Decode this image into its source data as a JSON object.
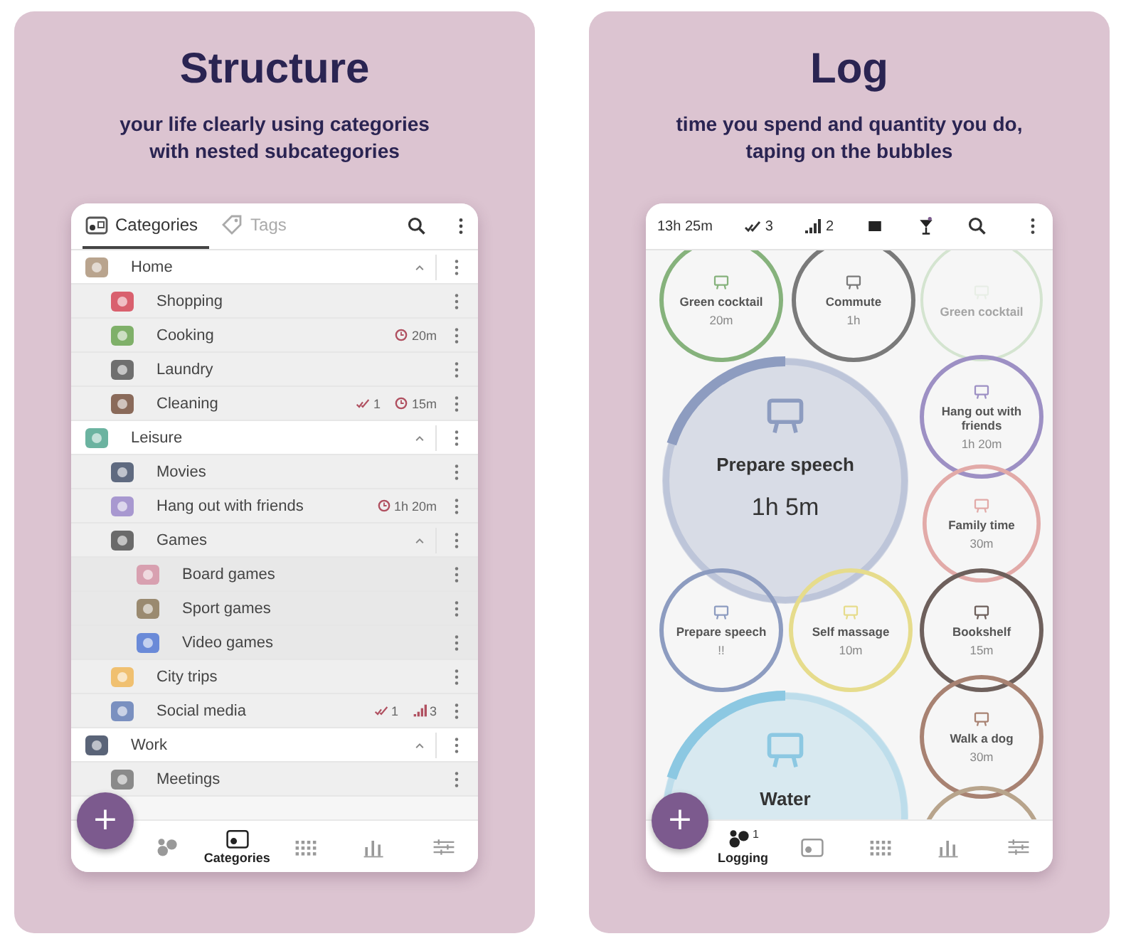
{
  "structure_panel": {
    "title": "Structure",
    "subtitle_lines": [
      "your life clearly using categories",
      "with nested subcategories"
    ],
    "phone": {
      "tabs": [
        {
          "label": "Categories",
          "kind": "categories",
          "selected": true
        },
        {
          "label": "Tags",
          "kind": "tags",
          "selected": false
        }
      ],
      "categories": [
        {
          "label": "Home",
          "color": "#b9a48e",
          "expanded": true,
          "children": [
            {
              "label": "Shopping",
              "color": "#d9606e"
            },
            {
              "label": "Cooking",
              "color": "#7fb069",
              "badges": [
                {
                  "kind": "timer",
                  "text": "20m"
                }
              ]
            },
            {
              "label": "Laundry",
              "color": "#6f6f6f"
            },
            {
              "label": "Cleaning",
              "color": "#8a6a5a",
              "badges": [
                {
                  "kind": "check",
                  "text": "1"
                },
                {
                  "kind": "timer",
                  "text": "15m"
                }
              ]
            }
          ]
        },
        {
          "label": "Leisure",
          "color": "#6bb3a0",
          "expanded": true,
          "children": [
            {
              "label": "Movies",
              "color": "#5f6a80"
            },
            {
              "label": "Hang out with friends",
              "color": "#a898d0",
              "badges": [
                {
                  "kind": "timer",
                  "text": "1h 20m"
                }
              ]
            },
            {
              "label": "Games",
              "color": "#6a6a6a",
              "expanded": true,
              "children": [
                {
                  "label": "Board games",
                  "color": "#d8a0b0"
                },
                {
                  "label": "Sport games",
                  "color": "#9a8a70"
                },
                {
                  "label": "Video games",
                  "color": "#6a8ad8"
                }
              ]
            },
            {
              "label": "City trips",
              "color": "#f0c070"
            },
            {
              "label": "Social media",
              "color": "#7a90c0",
              "badges": [
                {
                  "kind": "check",
                  "text": "1"
                },
                {
                  "kind": "count",
                  "text": "3"
                }
              ]
            }
          ]
        },
        {
          "label": "Work",
          "color": "#5a6478",
          "expanded": true,
          "children": [
            {
              "label": "Meetings",
              "color": "#8a8a8a"
            }
          ]
        }
      ],
      "fab": "+",
      "nav": [
        {
          "kind": "bubbles",
          "selected": false
        },
        {
          "kind": "categories",
          "label": "Categories",
          "selected": true
        },
        {
          "kind": "grid",
          "selected": false
        },
        {
          "kind": "bars",
          "selected": false
        },
        {
          "kind": "sliders",
          "selected": false
        }
      ]
    }
  },
  "log_panel": {
    "title": "Log",
    "subtitle_lines": [
      "time you spend and quantity you do,",
      "taping on the bubbles"
    ],
    "phone": {
      "stats": [
        {
          "kind": "text",
          "text": "13h 25m"
        },
        {
          "kind": "check",
          "text": "3"
        },
        {
          "kind": "count",
          "text": "2"
        },
        {
          "kind": "square"
        },
        {
          "kind": "cocktail"
        },
        {
          "kind": "search"
        },
        {
          "kind": "menu"
        }
      ],
      "bubbles": [
        {
          "label": "Green cocktail",
          "value": "20m",
          "color": "#86b27c",
          "kind": "small",
          "disabled": false
        },
        {
          "label": "Commute",
          "value": "1h",
          "color": "#7a7a7a",
          "kind": "small",
          "disabled": false
        },
        {
          "label": "Green cocktail",
          "color": "#d4e4d0",
          "kind": "small",
          "disabled": true
        },
        {
          "label": "Prepare speech",
          "value": "1h 5m",
          "color": "#8d9cc0",
          "kind": "big",
          "disabled": false
        },
        {
          "label": "Hang out with friends",
          "value": "1h 20m",
          "color": "#9d90c4",
          "kind": "small",
          "disabled": false
        },
        {
          "label": "Family time",
          "value": "30m",
          "color": "#e2aaa8",
          "kind": "small",
          "disabled": false
        },
        {
          "label": "Prepare speech",
          "value": "!!",
          "color": "#8d9cc0",
          "kind": "small",
          "disabled": false
        },
        {
          "label": "Self massage",
          "value": "10m",
          "color": "#e6dc8c",
          "kind": "small",
          "disabled": false
        },
        {
          "label": "Bookshelf",
          "value": "15m",
          "color": "#6e605c",
          "kind": "small",
          "disabled": false
        },
        {
          "label": "Walk a dog",
          "value": "30m",
          "color": "#a88272",
          "kind": "small",
          "disabled": false
        },
        {
          "label": "Water",
          "color": "#8cc8e2",
          "kind": "big",
          "disabled": false
        },
        {
          "color": "#b8a48c",
          "kind": "small",
          "disabled": false
        }
      ],
      "fab": "+",
      "nav": [
        {
          "kind": "bubbles",
          "label": "Logging",
          "badge": "1",
          "selected": true
        },
        {
          "kind": "categories",
          "selected": false
        },
        {
          "kind": "grid",
          "selected": false
        },
        {
          "kind": "bars",
          "selected": false
        },
        {
          "kind": "sliders",
          "selected": false
        }
      ]
    }
  }
}
